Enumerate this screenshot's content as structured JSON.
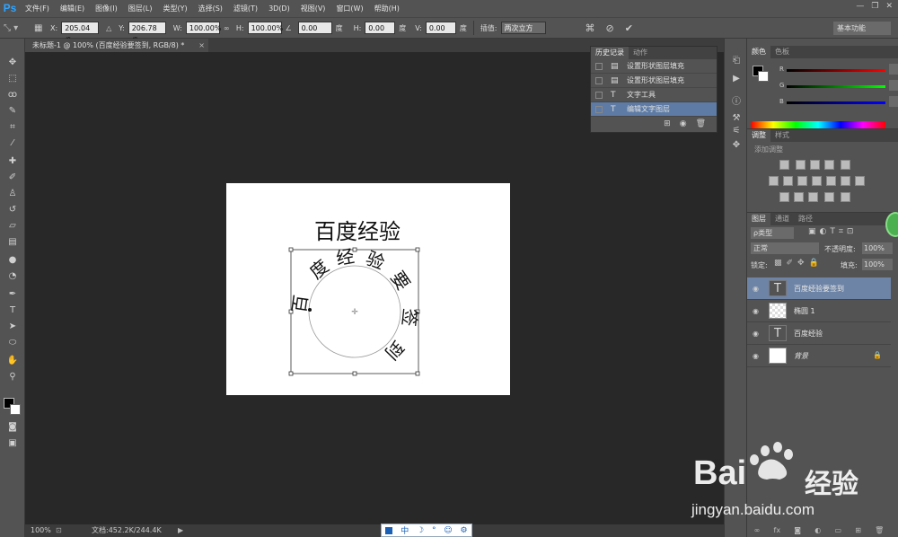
{
  "app": {
    "logo": "Ps"
  },
  "menu": [
    "文件(F)",
    "编辑(E)",
    "图像(I)",
    "图层(L)",
    "类型(Y)",
    "选择(S)",
    "滤镜(T)",
    "3D(D)",
    "视图(V)",
    "窗口(W)",
    "帮助(H)"
  ],
  "options": {
    "x_label": "X:",
    "x_value": "205.04 像",
    "y_label": "Y:",
    "y_value": "206.78 像",
    "w_label": "W:",
    "w_value": "100.00%",
    "h_label": "H:",
    "h_value": "100.00%",
    "rot_value": "0.00",
    "deg": "度",
    "hskew_label": "H:",
    "hskew_value": "0.00",
    "deg2": "度",
    "vskew_label": "V:",
    "vskew_value": "0.00",
    "deg3": "度",
    "interp_label": "插值:",
    "interp_value": "两次立方",
    "workspace": "基本功能"
  },
  "doc_tab": {
    "title": "未标题-1 @ 100% (百度经验要签到, RGB/8) *",
    "close": "×"
  },
  "canvas": {
    "title_text": "百度经验",
    "circle_text": [
      "百",
      "度",
      "经",
      "验",
      "要",
      "签",
      "到"
    ]
  },
  "status": {
    "zoom": "100%",
    "doc_info": "文档:452.2K/244.4K"
  },
  "ime": [
    "中",
    "☽",
    "°",
    "☺",
    "⚙"
  ],
  "history_panel": {
    "tabs": [
      "历史记录",
      "动作"
    ],
    "items": [
      {
        "label": "设置形状图层填充",
        "icon": "doc-icon",
        "selected": false
      },
      {
        "label": "设置形状图层填充",
        "icon": "doc-icon",
        "selected": false
      },
      {
        "label": "文字工具",
        "icon": "type-icon",
        "selected": false
      },
      {
        "label": "编辑文字图层",
        "icon": "type-icon",
        "selected": true
      }
    ]
  },
  "color_panel": {
    "tabs": [
      "颜色",
      "色板"
    ],
    "channels": [
      "R",
      "G",
      "B"
    ]
  },
  "adjust_panel": {
    "tabs": [
      "调整",
      "样式"
    ],
    "hint": "添加调整"
  },
  "layers_panel": {
    "tabs": [
      "图层",
      "通道",
      "路径"
    ],
    "filter": "ρ类型",
    "blend_mode": "正常",
    "opacity_label": "不透明度:",
    "opacity_value": "100%",
    "lock_label": "锁定:",
    "fill_label": "填充:",
    "fill_value": "100%",
    "layers": [
      {
        "name": "百度经验要签到",
        "kind": "text",
        "selected": true
      },
      {
        "name": "椭圆 1",
        "kind": "shape",
        "selected": false
      },
      {
        "name": "百度经验",
        "kind": "text",
        "selected": false
      },
      {
        "name": "背景",
        "kind": "background",
        "selected": false
      }
    ]
  },
  "watermark": {
    "brand": "Bai",
    "brand2": "经验",
    "url": "jingyan.baidu.com"
  }
}
